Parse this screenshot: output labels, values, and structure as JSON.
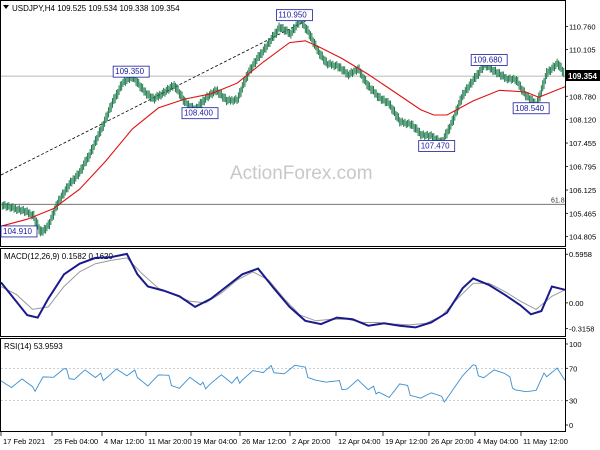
{
  "watermark": "ActionForex.com",
  "chart_data": [
    {
      "type": "line",
      "panel": "price",
      "title": "USDJPY,H4  109.525 109.534 109.338 109.354",
      "instrument": "USDJPY,H4",
      "ohlc": {
        "open": 109.525,
        "high": 109.534,
        "low": 109.338,
        "close": 109.354
      },
      "ylim": [
        104.54,
        111.28
      ],
      "y_ticks": [
        "110.760",
        "110.105",
        "109.435",
        "108.780",
        "108.120",
        "107.455",
        "106.795",
        "106.125",
        "105.465",
        "104.805"
      ],
      "last_price": "109.354",
      "x_ticks": [
        "17 Feb 2021",
        "25 Feb 04:00",
        "4 Mar 12:00",
        "11 Mar 20:00",
        "19 Mar 04:00",
        "26 Mar 12:00",
        "2 Apr 20:00",
        "12 Apr 04:00",
        "19 Apr 12:00",
        "26 Apr 20:00",
        "4 May 04:00",
        "11 May 12:00"
      ],
      "annotations": [
        {
          "label": "104.910",
          "value": 104.91
        },
        {
          "label": "109.350",
          "value": 109.35
        },
        {
          "label": "108.400",
          "value": 108.4
        },
        {
          "label": "110.950",
          "value": 110.95
        },
        {
          "label": "107.470",
          "value": 107.47
        },
        {
          "label": "109.680",
          "value": 109.68
        },
        {
          "label": "108.540",
          "value": 108.54
        }
      ],
      "horizontal_lines": [
        {
          "label": "",
          "value": 109.35,
          "color": "#a0a0a0"
        },
        {
          "label": "61.8",
          "value": 105.72,
          "color": "#606060"
        }
      ],
      "series": [
        {
          "name": "price",
          "color": "#1f7a4d",
          "x": [
            0,
            4,
            8,
            12,
            15,
            18,
            22,
            26,
            30,
            34,
            38,
            42,
            46,
            50,
            54,
            58,
            62,
            66,
            70,
            74,
            78,
            82,
            86,
            90,
            94,
            98,
            102,
            106,
            110,
            114,
            117,
            120,
            124,
            128,
            132,
            136,
            140,
            144,
            148,
            152,
            156,
            160,
            164,
            168,
            172,
            176,
            180,
            184,
            188,
            192,
            196,
            200,
            204,
            208,
            212,
            215
          ],
          "values": [
            105.72,
            105.62,
            105.55,
            105.42,
            104.91,
            105.15,
            105.85,
            106.3,
            106.65,
            107.2,
            107.85,
            108.55,
            109.15,
            109.35,
            108.95,
            108.7,
            108.9,
            109.1,
            108.6,
            108.4,
            108.75,
            108.95,
            108.65,
            108.7,
            109.45,
            109.9,
            110.3,
            110.75,
            110.55,
            110.95,
            110.6,
            110.15,
            109.7,
            109.65,
            109.4,
            109.55,
            109.05,
            108.75,
            108.55,
            108.05,
            108.0,
            107.7,
            107.65,
            107.47,
            108.1,
            108.85,
            109.25,
            109.68,
            109.5,
            109.3,
            109.25,
            108.8,
            108.54,
            109.45,
            109.72,
            109.35
          ]
        },
        {
          "name": "moving average",
          "color": "#e01010",
          "x": [
            0,
            10,
            20,
            30,
            40,
            50,
            60,
            70,
            80,
            90,
            100,
            110,
            116,
            122,
            130,
            140,
            150,
            160,
            165,
            170,
            180,
            190,
            200,
            205,
            210,
            215
          ],
          "values": [
            105.1,
            105.3,
            105.6,
            106.15,
            106.95,
            107.85,
            108.45,
            108.7,
            108.85,
            109.15,
            109.75,
            110.3,
            110.35,
            110.15,
            109.85,
            109.4,
            108.9,
            108.4,
            108.25,
            108.25,
            108.65,
            108.95,
            108.9,
            108.75,
            108.9,
            109.05
          ]
        },
        {
          "name": "trend line",
          "color": "#000000",
          "x": [
            0,
            117
          ],
          "values": [
            106.55,
            110.95
          ]
        }
      ]
    },
    {
      "type": "line",
      "panel": "macd",
      "title": "MACD(12,26,9)  0.1582 0.1620",
      "ylim": [
        -0.4058,
        0.6595
      ],
      "y_ticks": [
        "0.5958",
        "0.00",
        "-0.3158"
      ],
      "series": [
        {
          "name": "MACD",
          "color": "#1a1a8c",
          "x": [
            0,
            5,
            10,
            14,
            18,
            24,
            30,
            36,
            42,
            48,
            52,
            56,
            62,
            68,
            74,
            80,
            86,
            92,
            98,
            104,
            110,
            116,
            122,
            128,
            134,
            140,
            146,
            152,
            158,
            164,
            170,
            176,
            180,
            186,
            192,
            198,
            202,
            206,
            210,
            215
          ],
          "values": [
            0.25,
            0.05,
            -0.15,
            -0.18,
            0.05,
            0.35,
            0.48,
            0.55,
            0.56,
            0.6,
            0.35,
            0.2,
            0.15,
            0.08,
            -0.05,
            0.05,
            0.2,
            0.35,
            0.42,
            0.18,
            -0.05,
            -0.22,
            -0.26,
            -0.18,
            -0.2,
            -0.28,
            -0.25,
            -0.28,
            -0.3,
            -0.24,
            -0.12,
            0.18,
            0.3,
            0.22,
            0.1,
            -0.03,
            -0.14,
            -0.1,
            0.2,
            0.16
          ]
        },
        {
          "name": "Signal",
          "color": "#9a9a9a",
          "x": [
            0,
            6,
            12,
            18,
            24,
            30,
            36,
            42,
            48,
            54,
            60,
            66,
            72,
            78,
            84,
            90,
            96,
            102,
            108,
            114,
            120,
            126,
            132,
            138,
            144,
            150,
            156,
            162,
            168,
            174,
            180,
            186,
            192,
            198,
            204,
            210,
            215
          ],
          "values": [
            0.2,
            0.1,
            -0.08,
            -0.05,
            0.2,
            0.38,
            0.48,
            0.52,
            0.55,
            0.35,
            0.18,
            0.1,
            0.02,
            0.0,
            0.12,
            0.28,
            0.38,
            0.28,
            0.05,
            -0.15,
            -0.22,
            -0.2,
            -0.2,
            -0.24,
            -0.24,
            -0.26,
            -0.27,
            -0.25,
            -0.16,
            0.05,
            0.24,
            0.24,
            0.14,
            0.02,
            -0.08,
            0.08,
            0.16
          ]
        }
      ]
    },
    {
      "type": "line",
      "panel": "rsi",
      "title": "RSI(14)  53.9593",
      "ylim": [
        0,
        100
      ],
      "y_ticks": [
        "100",
        "70",
        "30",
        "0"
      ],
      "reference_levels": [
        70,
        30
      ],
      "series": [
        {
          "name": "RSI",
          "color": "#3a8fd0",
          "x": [
            0,
            4,
            8,
            12,
            16,
            20,
            24,
            28,
            32,
            36,
            40,
            44,
            48,
            52,
            56,
            60,
            64,
            68,
            72,
            76,
            80,
            84,
            88,
            92,
            96,
            100,
            104,
            108,
            112,
            116,
            120,
            124,
            128,
            132,
            136,
            140,
            144,
            148,
            152,
            156,
            160,
            164,
            168,
            172,
            176,
            180,
            184,
            188,
            192,
            196,
            200,
            204,
            208,
            212,
            215
          ],
          "values": [
            60,
            48,
            55,
            42,
            62,
            58,
            65,
            60,
            68,
            55,
            62,
            70,
            58,
            64,
            50,
            60,
            56,
            48,
            58,
            45,
            55,
            62,
            48,
            60,
            68,
            62,
            70,
            65,
            72,
            66,
            58,
            52,
            50,
            48,
            56,
            40,
            45,
            35,
            48,
            42,
            35,
            38,
            30,
            45,
            60,
            70,
            62,
            68,
            60,
            48,
            42,
            40,
            65,
            72,
            54
          ]
        }
      ]
    }
  ]
}
